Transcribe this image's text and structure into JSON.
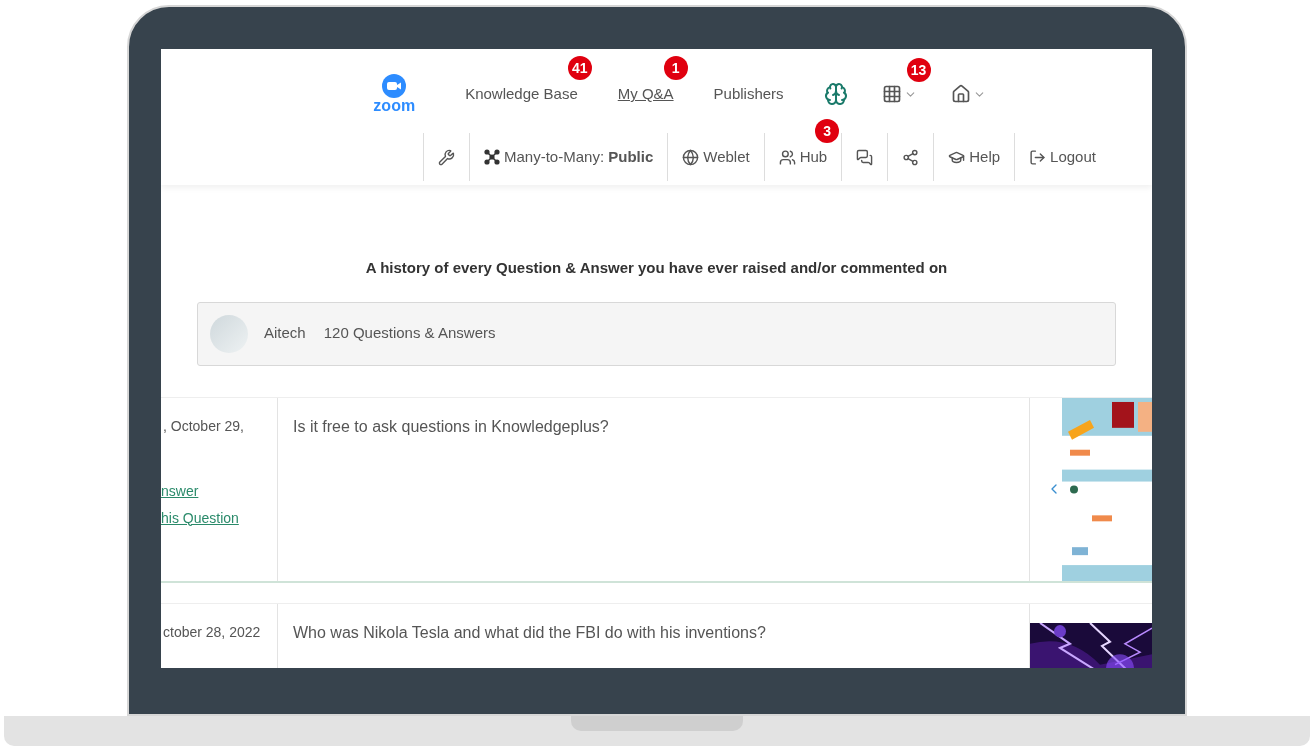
{
  "logo": {
    "text": "zoom"
  },
  "top_nav": [
    {
      "label": "Knowledge Base",
      "badge": "41",
      "selected": false
    },
    {
      "label": "My Q&A",
      "badge": "1",
      "selected": true
    },
    {
      "label": "Publishers",
      "selected": false
    }
  ],
  "menus": [
    {
      "kind": "brain"
    },
    {
      "kind": "grid",
      "badge": "13"
    },
    {
      "kind": "home"
    }
  ],
  "toolbar": [
    {
      "kind": "tools"
    },
    {
      "kind": "mode",
      "label": "Many-to-Many: **Public**"
    },
    {
      "kind": "weblet",
      "label": "Weblet"
    },
    {
      "kind": "hub",
      "label": "Hub",
      "badge": "3"
    },
    {
      "kind": "chat"
    },
    {
      "kind": "share"
    },
    {
      "kind": "help",
      "label": "Help"
    },
    {
      "kind": "logout",
      "label": "Logout"
    }
  ],
  "heading": "A history of every Question & Answer you have ever raised and/or commented on",
  "profile": {
    "name": "Aitech",
    "count": "120 Questions & Answers"
  },
  "rows": [
    {
      "date": ", October 29,",
      "links": [
        "nswer",
        "his Question"
      ],
      "question": "Is it free to ask questions in Knowledgeplus?",
      "thumbnail": {
        "kind": "guide"
      }
    },
    {
      "date": "ctober 28, 2022",
      "links": [],
      "question": "Who was Nikola Tesla and what did the FBI do with his inventions?",
      "thumbnail": {
        "kind": "lightning"
      }
    }
  ]
}
